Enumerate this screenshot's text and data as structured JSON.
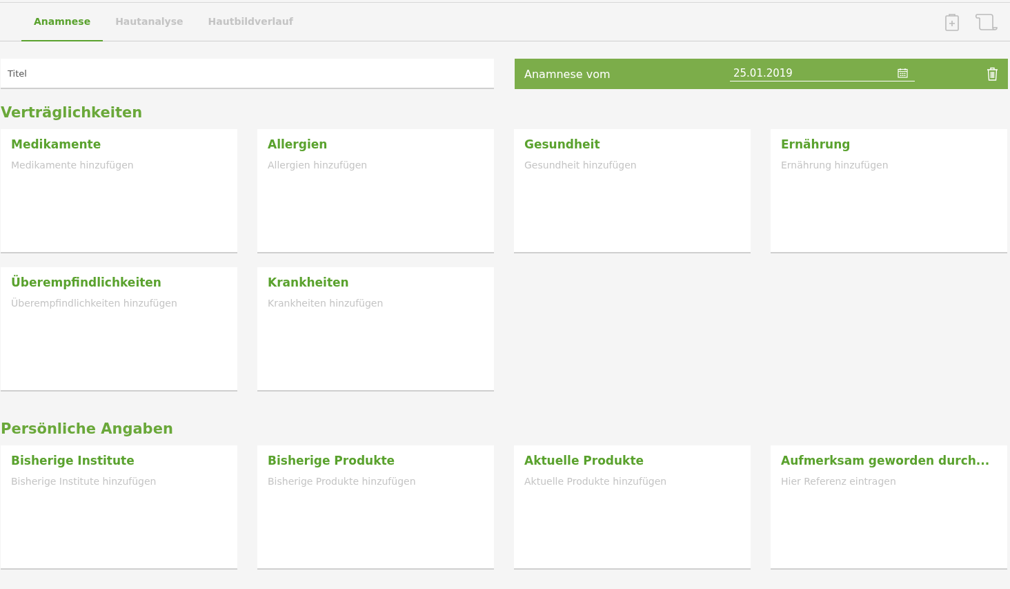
{
  "tabs": [
    {
      "label": "Anamnese",
      "selected": true
    },
    {
      "label": "Hautanalyse",
      "selected": false
    },
    {
      "label": "Hautbildverlauf",
      "selected": false
    }
  ],
  "title_field": {
    "placeholder": "Titel"
  },
  "date_bar": {
    "label": "Anamnese vom",
    "date": "25.01.2019"
  },
  "sections": [
    {
      "heading": "Verträglichkeiten",
      "cards": [
        {
          "title": "Medikamente",
          "placeholder": "Medikamente hinzufügen"
        },
        {
          "title": "Allergien",
          "placeholder": "Allergien hinzufügen"
        },
        {
          "title": "Gesundheit",
          "placeholder": "Gesundheit hinzufügen"
        },
        {
          "title": "Ernährung",
          "placeholder": "Ernährung hinzufügen"
        },
        {
          "title": "Überempfindlichkeiten",
          "placeholder": "Überempfindlichkeiten hinzufügen"
        },
        {
          "title": "Krankheiten",
          "placeholder": "Krankheiten hinzufügen"
        }
      ]
    },
    {
      "heading": "Persönliche Angaben",
      "cards": [
        {
          "title": "Bisherige Institute",
          "placeholder": "Bisherige Institute hinzufügen"
        },
        {
          "title": "Bisherige Produkte",
          "placeholder": "Bisherige Produkte hinzufügen"
        },
        {
          "title": "Aktuelle Produkte",
          "placeholder": "Aktuelle Produkte hinzufügen"
        },
        {
          "title": "Aufmerksam geworden durch...",
          "placeholder": "Hier Referenz eintragen"
        }
      ]
    }
  ]
}
